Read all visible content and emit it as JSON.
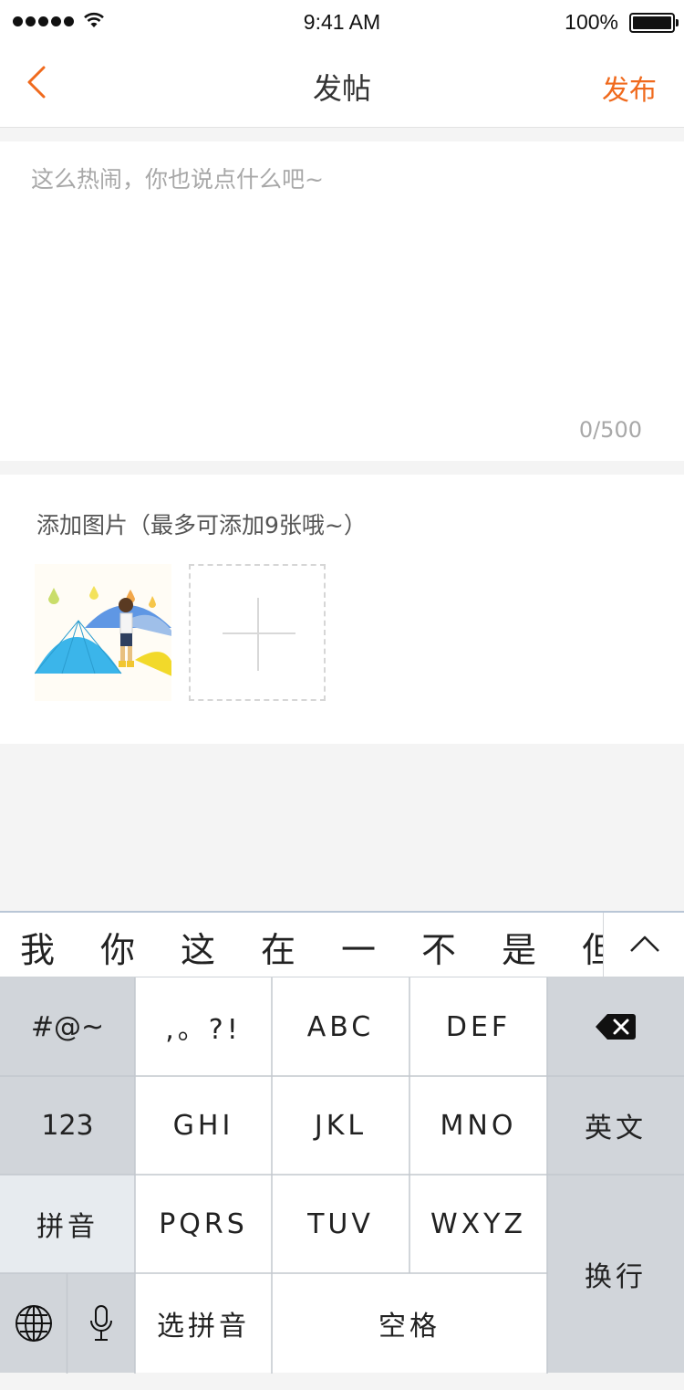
{
  "status_bar": {
    "time": "9:41 AM",
    "battery_percent": "100%",
    "signal_icon": "signal-dots-icon",
    "wifi_icon": "wifi-icon",
    "battery_icon": "battery-icon"
  },
  "nav": {
    "back_icon": "chevron-left-icon",
    "title": "发帖",
    "publish_label": "发布",
    "accent_color": "#f06a1d"
  },
  "editor": {
    "placeholder": "这么热闹，你也说点什么吧~",
    "value": "",
    "counter": "0/500"
  },
  "images": {
    "label": "添加图片（最多可添加9张哦~）",
    "thumbnails": [
      "child-with-umbrellas-photo"
    ],
    "add_icon": "plus-icon"
  },
  "keyboard": {
    "candidates": [
      "我",
      "你",
      "这",
      "在",
      "一",
      "不",
      "是",
      "但"
    ],
    "expand_icon": "chevron-up-icon",
    "keys": {
      "symbols": "#@~",
      "punct": ",。?!",
      "abc": "ABC",
      "def": "DEF",
      "delete_icon": "backspace-icon",
      "num": "123",
      "ghi": "GHI",
      "jkl": "JKL",
      "mno": "MNO",
      "english": "英文",
      "pinyin": "拼音",
      "pqrs": "PQRS",
      "tuv": "TUV",
      "wxyz": "WXYZ",
      "enter": "换行",
      "globe_icon": "globe-icon",
      "mic_icon": "microphone-icon",
      "choose_pinyin": "选拼音",
      "space": "空格"
    }
  }
}
